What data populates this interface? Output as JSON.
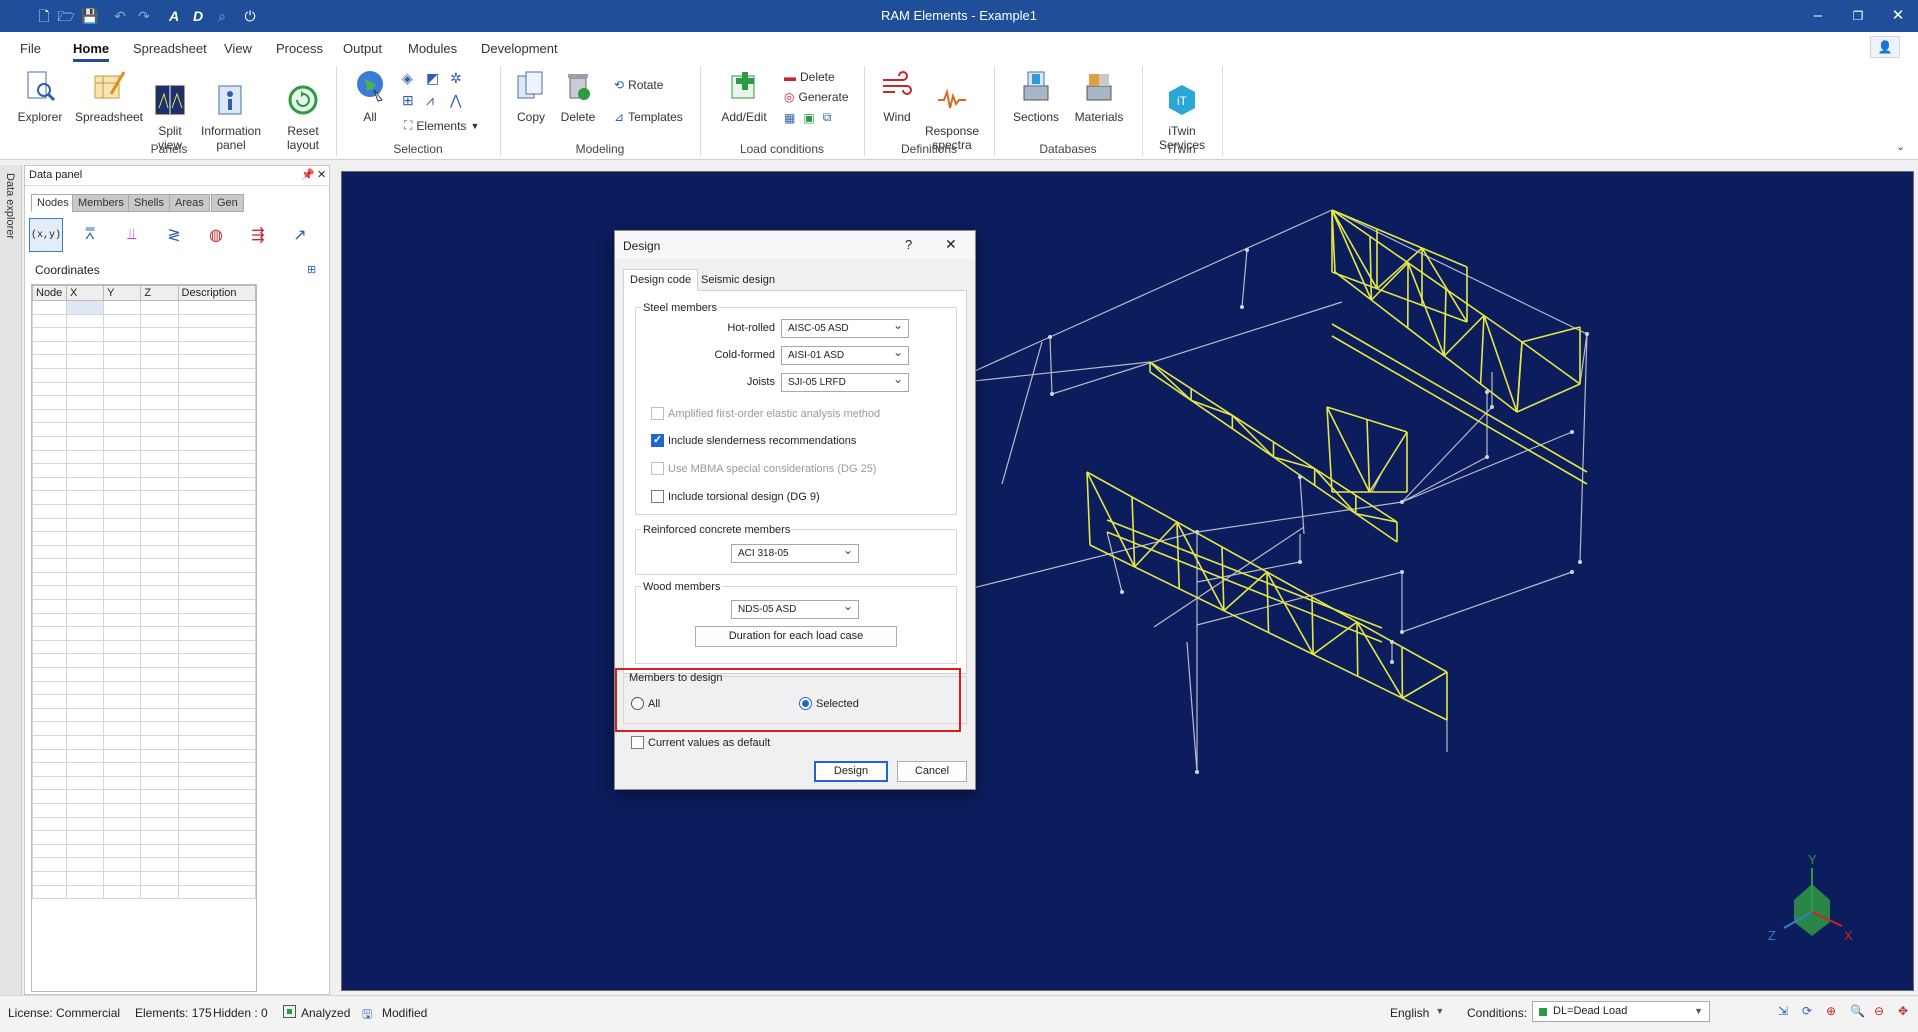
{
  "window": {
    "title": "RAM Elements - Example1"
  },
  "menu": {
    "tabs": [
      "File",
      "Home",
      "Spreadsheet",
      "View",
      "Process",
      "Output",
      "Modules",
      "Development"
    ],
    "active": "Home"
  },
  "ribbon": {
    "panels": {
      "label": "Panels",
      "buttons": [
        "Explorer",
        "Spreadsheet",
        "Split\nview",
        "Information\npanel",
        "Reset\nlayout"
      ]
    },
    "selection": {
      "label": "Selection",
      "all": "All",
      "elements": "Elements"
    },
    "modeling": {
      "label": "Modeling",
      "copy": "Copy",
      "delete": "Delete",
      "rotate": "Rotate",
      "templates": "Templates"
    },
    "load_conditions": {
      "label": "Load conditions",
      "add_edit": "Add/Edit",
      "delete": "Delete",
      "generate": "Generate"
    },
    "definitions": {
      "label": "Definitions",
      "wind": "Wind",
      "response_spectra": "Response\nspectra"
    },
    "databases": {
      "label": "Databases",
      "sections": "Sections",
      "materials": "Materials"
    },
    "itwin": {
      "label": "iTwin",
      "services": "iTwin\nServices"
    }
  },
  "side_strip": {
    "label": "Data explorer"
  },
  "data_panel": {
    "title": "Data panel",
    "tabs": [
      "Nodes",
      "Members",
      "Shells",
      "Areas",
      "Gen"
    ],
    "active_tab": "Nodes",
    "section": "Coordinates",
    "columns": [
      "Node",
      "X",
      "Y",
      "Z",
      "Description"
    ]
  },
  "dialog": {
    "title": "Design",
    "help": "?",
    "tabs": [
      "Design code",
      "Seismic design"
    ],
    "steel": {
      "legend": "Steel members",
      "hot_rolled_label": "Hot-rolled",
      "hot_rolled_value": "AISC-05 ASD",
      "cold_formed_label": "Cold-formed",
      "cold_formed_value": "AISI-01 ASD",
      "joists_label": "Joists",
      "joists_value": "SJI-05 LRFD",
      "opt1": "Amplified first-order elastic analysis method",
      "opt2": "Include slenderness recommendations",
      "opt3": "Use MBMA special considerations (DG 25)",
      "opt4": "Include torsional design (DG 9)"
    },
    "concrete": {
      "legend": "Reinforced concrete members",
      "value": "ACI 318-05"
    },
    "wood": {
      "legend": "Wood members",
      "value": "NDS-05 ASD",
      "button": "Duration for each load case"
    },
    "members_to_design": {
      "legend": "Members to design",
      "all": "All",
      "selected": "Selected",
      "choice": "Selected"
    },
    "current_default": "Current values as default",
    "design_button": "Design",
    "cancel_button": "Cancel"
  },
  "status": {
    "license": "License: Commercial",
    "elements": "Elements: 175",
    "hidden": "Hidden : 0",
    "analyzed": "Analyzed",
    "modified": "Modified",
    "language": "English",
    "conditions_label": "Conditions:",
    "conditions_value": "DL=Dead Load"
  },
  "axes": {
    "y": "Y",
    "z": "Z",
    "x": "X"
  },
  "colors": {
    "titlebar": "#1f4e9a",
    "viewport": "#0b1d5c",
    "truss": "#e6e645",
    "frame": "#b8bcc8",
    "highlight": "#d32020"
  }
}
